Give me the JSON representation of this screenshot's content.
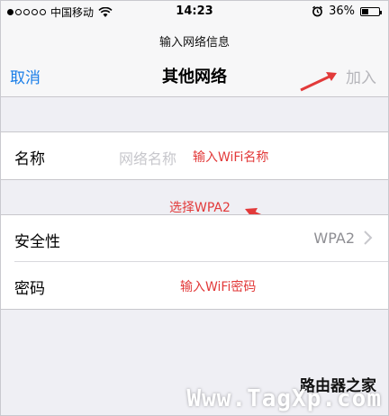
{
  "status_bar": {
    "carrier": "中国移动",
    "time": "14:23",
    "battery_percent": "36%",
    "battery_level": 0.36
  },
  "nav": {
    "prompt": "输入网络信息",
    "cancel_label": "取消",
    "title": "其他网络",
    "join_label": "加入"
  },
  "name_row": {
    "label": "名称",
    "placeholder": "网络名称"
  },
  "security_row": {
    "label": "安全性",
    "value": "WPA2"
  },
  "password_row": {
    "label": "密码"
  },
  "annotations": {
    "enter_name": "输入WiFi名称",
    "choose_wpa2": "选择WPA2",
    "enter_password": "输入WiFi密码"
  },
  "watermark": {
    "brand": "路由器之家",
    "url": "Www.TagXp.com"
  },
  "colors": {
    "accent": "#1a7ee8",
    "annotation": "#e23a3a",
    "disabled": "#b6b6bb",
    "background": "#efeff4"
  }
}
